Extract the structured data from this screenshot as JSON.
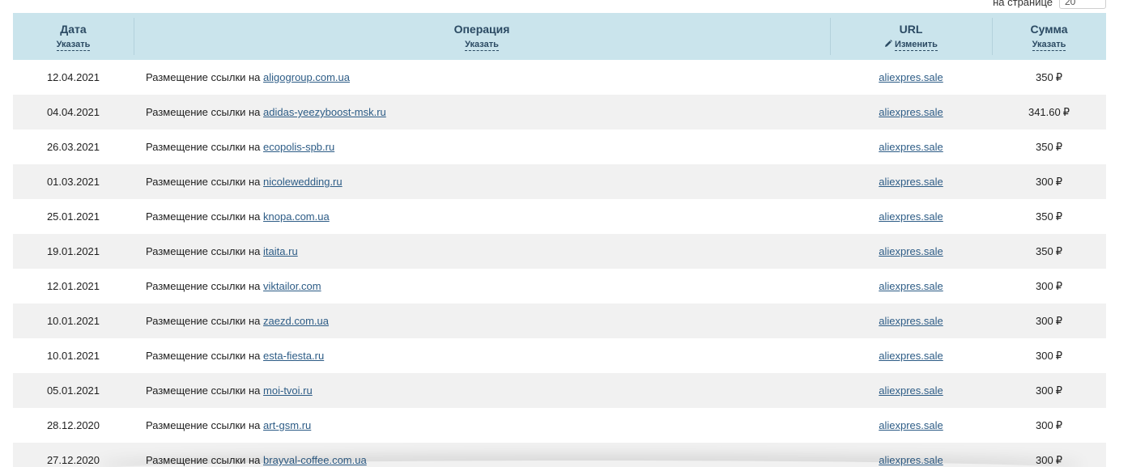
{
  "per_page": {
    "label": "на странице",
    "value": "20"
  },
  "table": {
    "headers": {
      "date": {
        "title": "Дата",
        "action": "Указать"
      },
      "operation": {
        "title": "Операция",
        "action": "Указать"
      },
      "url": {
        "title": "URL",
        "action": "Изменить",
        "action_icon": "pencil-icon"
      },
      "sum": {
        "title": "Сумма",
        "action": "Указать"
      }
    },
    "operation_prefix": "Размещение ссылки на",
    "currency": "₽",
    "rows": [
      {
        "date": "12.04.2021",
        "site": "aligogroup.com.ua",
        "url": "aliexpres.sale",
        "sum": "350"
      },
      {
        "date": "04.04.2021",
        "site": "adidas-yeezyboost-msk.ru",
        "url": "aliexpres.sale",
        "sum": "341.60"
      },
      {
        "date": "26.03.2021",
        "site": "ecopolis-spb.ru",
        "url": "aliexpres.sale",
        "sum": "350"
      },
      {
        "date": "01.03.2021",
        "site": "nicolewedding.ru",
        "url": "aliexpres.sale",
        "sum": "300"
      },
      {
        "date": "25.01.2021",
        "site": "knopa.com.ua",
        "url": "aliexpres.sale",
        "sum": "350"
      },
      {
        "date": "19.01.2021",
        "site": "itaita.ru",
        "url": "aliexpres.sale",
        "sum": "350"
      },
      {
        "date": "12.01.2021",
        "site": "viktailor.com",
        "url": "aliexpres.sale",
        "sum": "300"
      },
      {
        "date": "10.01.2021",
        "site": "zaezd.com.ua",
        "url": "aliexpres.sale",
        "sum": "300"
      },
      {
        "date": "10.01.2021",
        "site": "esta-fiesta.ru",
        "url": "aliexpres.sale",
        "sum": "300"
      },
      {
        "date": "05.01.2021",
        "site": "moi-tvoi.ru",
        "url": "aliexpres.sale",
        "sum": "300"
      },
      {
        "date": "28.12.2020",
        "site": "art-gsm.ru",
        "url": "aliexpres.sale",
        "sum": "300"
      },
      {
        "date": "27.12.2020",
        "site": "brayval-coffee.com.ua",
        "url": "aliexpres.sale",
        "sum": "300"
      }
    ]
  }
}
